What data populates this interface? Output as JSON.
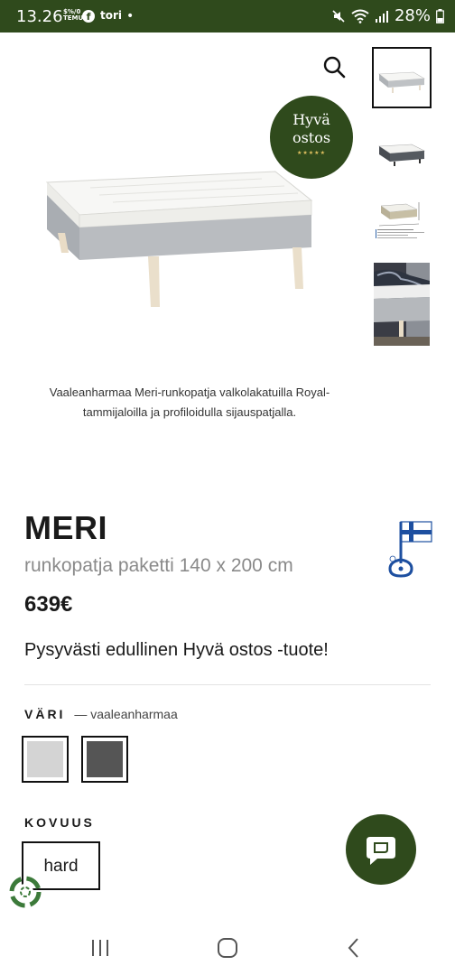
{
  "status_bar": {
    "time": "13.26",
    "temu_line1": "$%/0",
    "temu_line2": "TEMU",
    "tori": "tori",
    "dot": "•",
    "battery": "28%"
  },
  "badge": {
    "line1": "Hyvä",
    "line2": "ostos",
    "stars": "★★★★★"
  },
  "product": {
    "caption": "Vaaleanharmaa Meri-runkopatja valkolakatuilla Royal-tammijaloilla ja profiloidulla sijauspatjalla.",
    "name": "MERI",
    "subtitle": "runkopatja paketti 140 x 200 cm",
    "price": "639€",
    "tagline": "Pysyvästi edullinen Hyvä ostos -tuote!"
  },
  "color": {
    "label": "VÄRI",
    "selected": "— vaaleanharmaa",
    "swatches": [
      {
        "name": "vaaleanharmaa",
        "hex": "#d4d4d4"
      },
      {
        "name": "tummanharmaa",
        "hex": "#555555"
      }
    ]
  },
  "firmness": {
    "label": "KOVUUS",
    "option": "hard"
  },
  "colors": {
    "brand_green": "#2f4a1c",
    "mattress_gray": "#b9bcc0"
  }
}
